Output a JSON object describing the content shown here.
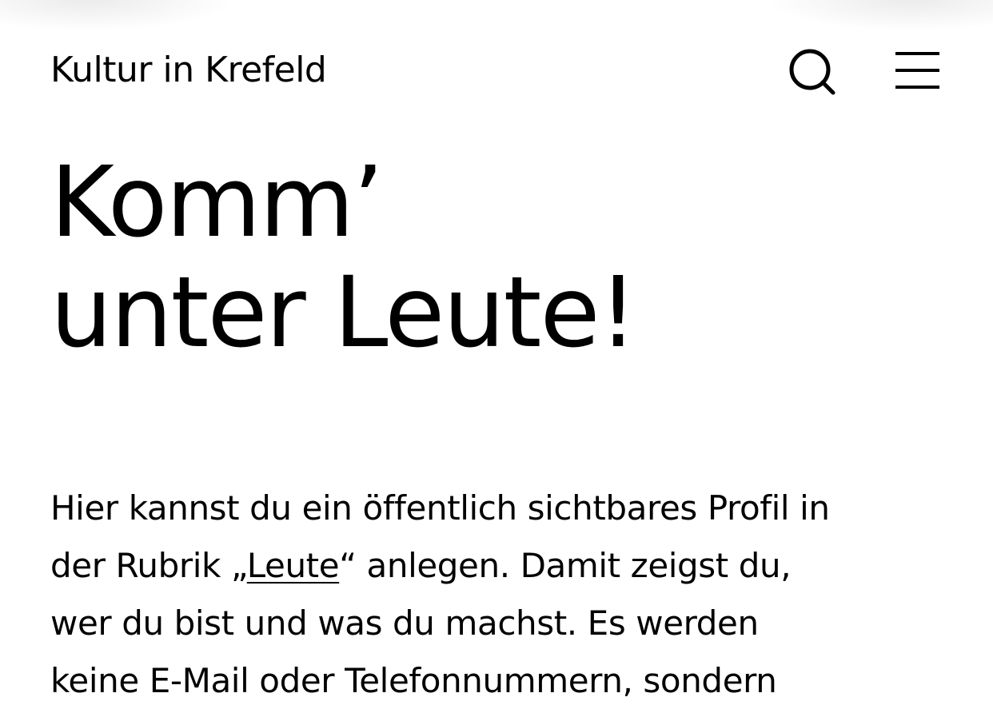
{
  "header": {
    "site_title": "Kultur in Krefeld",
    "search_icon": "search-icon",
    "menu_icon": "hamburger-menu-icon"
  },
  "hero": {
    "headline_line1": "Komm’",
    "headline_line2": "unter Leute!"
  },
  "intro": {
    "line1": "Hier kannst du ein öffentlich sichtbares Profil in",
    "line2_before": "der Rubrik „",
    "line2_link": "Leute",
    "line2_after": "“ anlegen. Damit zeigst du,",
    "line3": "wer du bist und was du machst. Es werden",
    "line4": "keine E-Mail oder Telefonnummern, sondern"
  },
  "colors": {
    "text": "#000000",
    "background": "#ffffff"
  }
}
